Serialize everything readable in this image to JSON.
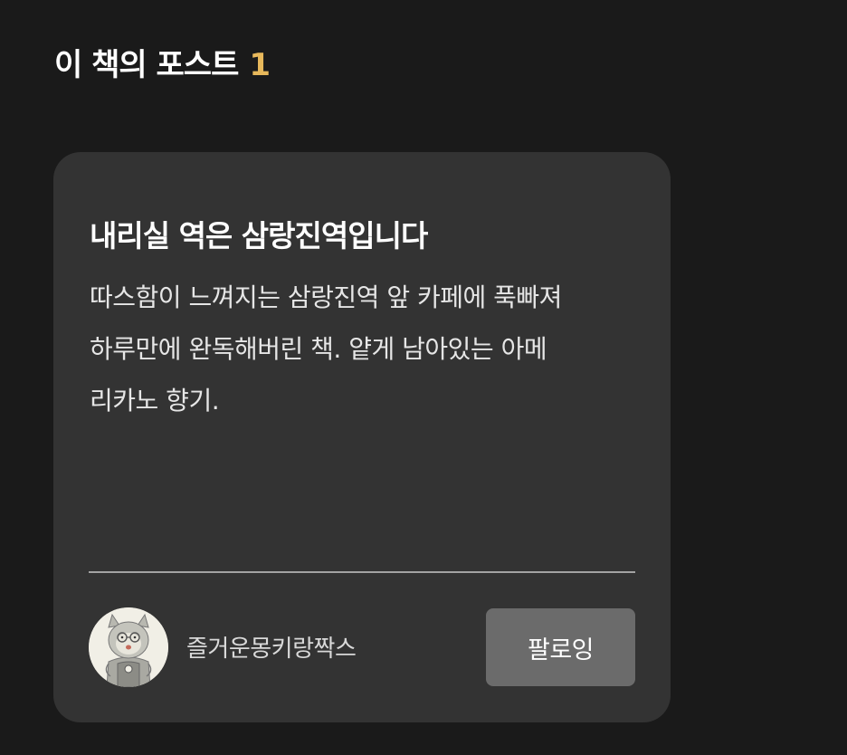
{
  "section": {
    "title": "이 책의 포스트",
    "count": "1"
  },
  "post": {
    "title": "내리실 역은 삼랑진역입니다",
    "body_lines": [
      "따스함이 느껴지는 삼랑진역 앞 카페에 푹빠져",
      "하루만에 완독해버린 책. 얕게 남아있는 아메",
      "리카노 향기."
    ],
    "author": {
      "name": "즐거운몽키랑짝스",
      "avatar_icon": "monkey-character-avatar"
    },
    "follow_label": "팔로잉"
  },
  "colors": {
    "background": "#1a1a1a",
    "card": "#333333",
    "accent": "#e7b85b",
    "button": "#6b6b6b"
  }
}
